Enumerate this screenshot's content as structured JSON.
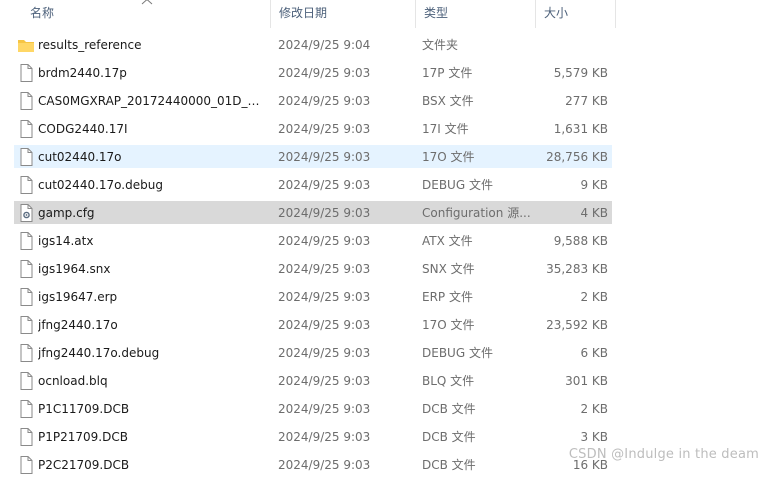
{
  "header": {
    "name": "名称",
    "date": "修改日期",
    "type": "类型",
    "size": "大小"
  },
  "files": [
    {
      "name": "results_reference",
      "date": "2024/9/25 9:04",
      "type": "文件夹",
      "size": "",
      "icon": "folder-icon"
    },
    {
      "name": "brdm2440.17p",
      "date": "2024/9/25 9:03",
      "type": "17P 文件",
      "size": "5,579 KB",
      "icon": "file-icon"
    },
    {
      "name": "CAS0MGXRAP_20172440000_01D_01...",
      "date": "2024/9/25 9:03",
      "type": "BSX 文件",
      "size": "277 KB",
      "icon": "file-icon"
    },
    {
      "name": "CODG2440.17I",
      "date": "2024/9/25 9:03",
      "type": "17I 文件",
      "size": "1,631 KB",
      "icon": "file-icon"
    },
    {
      "name": "cut02440.17o",
      "date": "2024/9/25 9:03",
      "type": "17O 文件",
      "size": "28,756 KB",
      "icon": "file-icon",
      "state": "hover"
    },
    {
      "name": "cut02440.17o.debug",
      "date": "2024/9/25 9:03",
      "type": "DEBUG 文件",
      "size": "9 KB",
      "icon": "file-icon"
    },
    {
      "name": "gamp.cfg",
      "date": "2024/9/25 9:03",
      "type": "Configuration 源...",
      "size": "4 KB",
      "icon": "config-file-icon",
      "state": "selected"
    },
    {
      "name": "igs14.atx",
      "date": "2024/9/25 9:03",
      "type": "ATX 文件",
      "size": "9,588 KB",
      "icon": "file-icon"
    },
    {
      "name": "igs1964.snx",
      "date": "2024/9/25 9:03",
      "type": "SNX 文件",
      "size": "35,283 KB",
      "icon": "file-icon"
    },
    {
      "name": "igs19647.erp",
      "date": "2024/9/25 9:03",
      "type": "ERP 文件",
      "size": "2 KB",
      "icon": "file-icon"
    },
    {
      "name": "jfng2440.17o",
      "date": "2024/9/25 9:03",
      "type": "17O 文件",
      "size": "23,592 KB",
      "icon": "file-icon"
    },
    {
      "name": "jfng2440.17o.debug",
      "date": "2024/9/25 9:03",
      "type": "DEBUG 文件",
      "size": "6 KB",
      "icon": "file-icon"
    },
    {
      "name": "ocnload.blq",
      "date": "2024/9/25 9:03",
      "type": "BLQ 文件",
      "size": "301 KB",
      "icon": "file-icon"
    },
    {
      "name": "P1C11709.DCB",
      "date": "2024/9/25 9:03",
      "type": "DCB 文件",
      "size": "2 KB",
      "icon": "file-icon"
    },
    {
      "name": "P1P21709.DCB",
      "date": "2024/9/25 9:03",
      "type": "DCB 文件",
      "size": "3 KB",
      "icon": "file-icon"
    },
    {
      "name": "P2C21709.DCB",
      "date": "2024/9/25 9:03",
      "type": "DCB 文件",
      "size": "16 KB",
      "icon": "file-icon"
    }
  ],
  "watermark": "CSDN @Indulge in the deam",
  "colors": {
    "hover_row": "#e5f3ff",
    "selected_row": "#d9d9d9",
    "folder": "#f6c544",
    "header_text": "#4c607a"
  }
}
